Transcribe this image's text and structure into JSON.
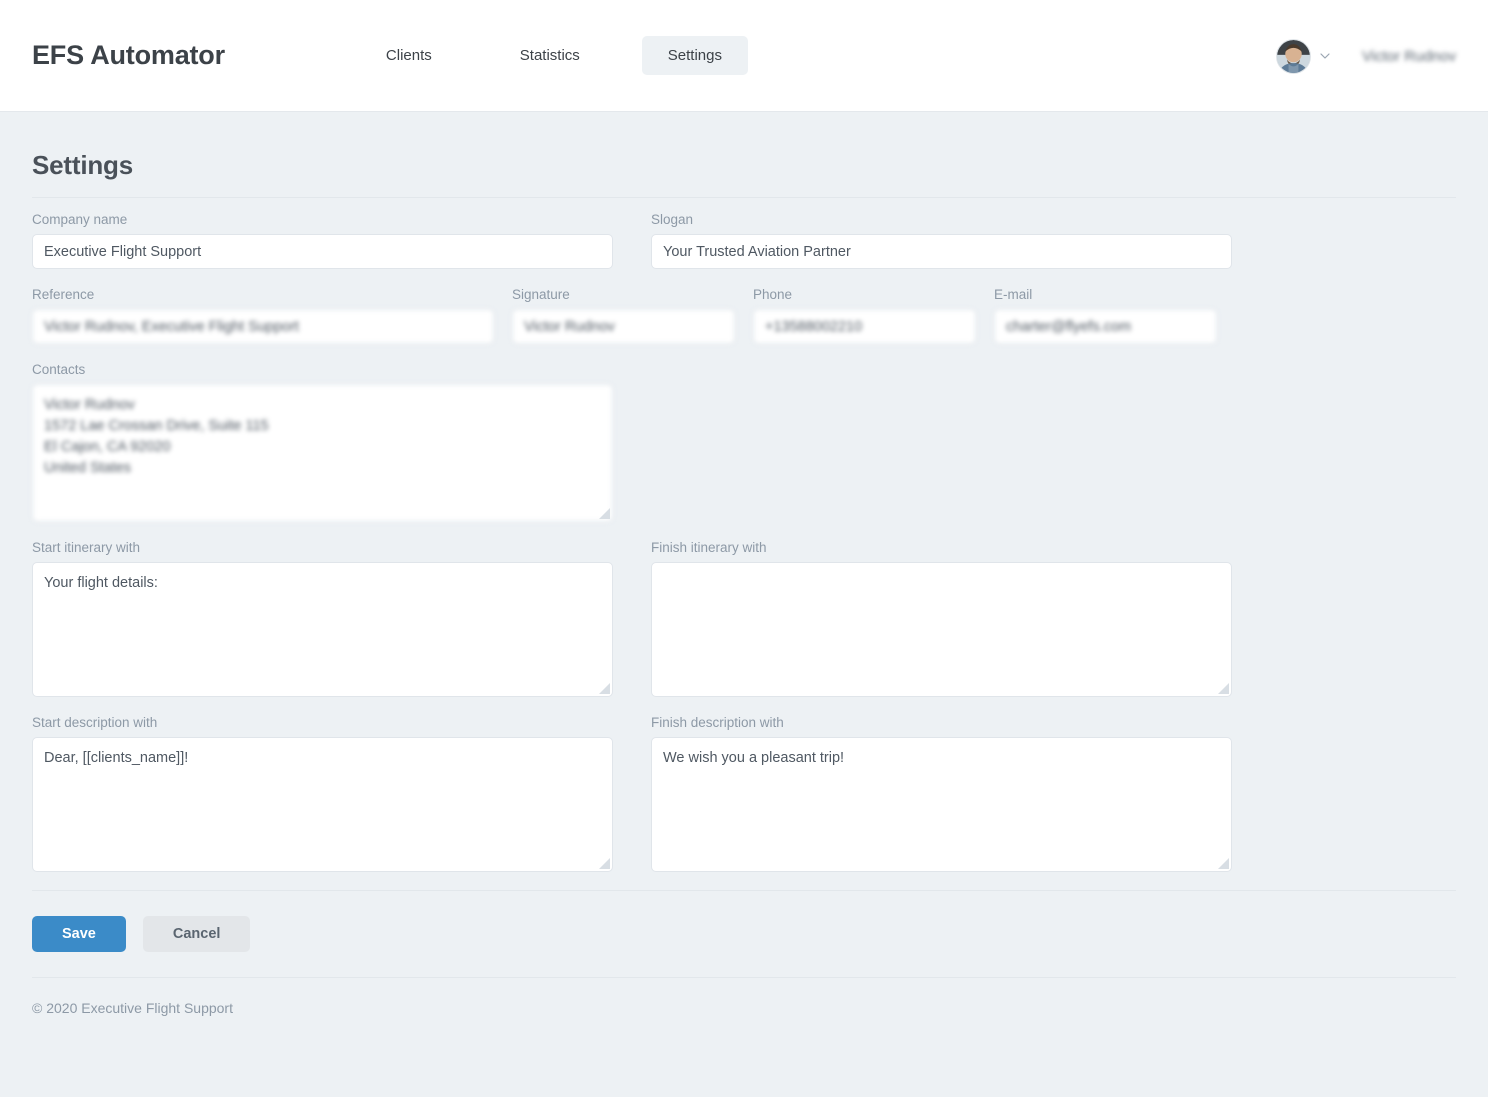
{
  "header": {
    "brand": "EFS Automator",
    "nav": [
      {
        "label": "Clients",
        "active": false
      },
      {
        "label": "Statistics",
        "active": false
      },
      {
        "label": "Settings",
        "active": true
      }
    ],
    "user": {
      "name": "Victor Rudnov",
      "avatar_icon": "user-avatar-photo",
      "chevron_icon": "chevron-down-icon"
    }
  },
  "page": {
    "title": "Settings"
  },
  "form": {
    "company_name": {
      "label": "Company name",
      "value": "Executive Flight Support",
      "placeholder": ""
    },
    "slogan": {
      "label": "Slogan",
      "value": "Your Trusted Aviation Partner",
      "placeholder": ""
    },
    "reference": {
      "label": "Reference",
      "value": "Victor Rudnov, Executive Flight Support",
      "placeholder": ""
    },
    "signature": {
      "label": "Signature",
      "value": "Victor Rudnov",
      "placeholder": ""
    },
    "phone": {
      "label": "Phone",
      "value": "+13588002210",
      "placeholder": ""
    },
    "email": {
      "label": "E-mail",
      "value": "charter@flyefs.com",
      "placeholder": ""
    },
    "contacts": {
      "label": "Contacts",
      "value": "Victor Rudnov\n1572 Lae Crossan Drive, Suite 115\nEl Cajon, CA 92020\nUnited States",
      "placeholder": ""
    },
    "start_itinerary": {
      "label": "Start itinerary with",
      "value": "Your flight details:",
      "placeholder": ""
    },
    "finish_itinerary": {
      "label": "Finish itinerary with",
      "value": "",
      "placeholder": ""
    },
    "start_description": {
      "label": "Start description with",
      "value": "Dear, [[clients_name]]!",
      "placeholder": ""
    },
    "finish_description": {
      "label": "Finish description with",
      "value": "We wish you a pleasant trip!",
      "placeholder": ""
    }
  },
  "actions": {
    "save_label": "Save",
    "cancel_label": "Cancel"
  },
  "footer": {
    "copyright": "© 2020 Executive Flight Support"
  },
  "colors": {
    "page_background": "#edf1f4",
    "header_background": "#ffffff",
    "primary_button": "#3b8bc8",
    "secondary_button": "#e3e6e9",
    "label_text": "#8d99a6",
    "input_border": "#e0e5ea",
    "active_tab_background": "#edf1f4"
  }
}
